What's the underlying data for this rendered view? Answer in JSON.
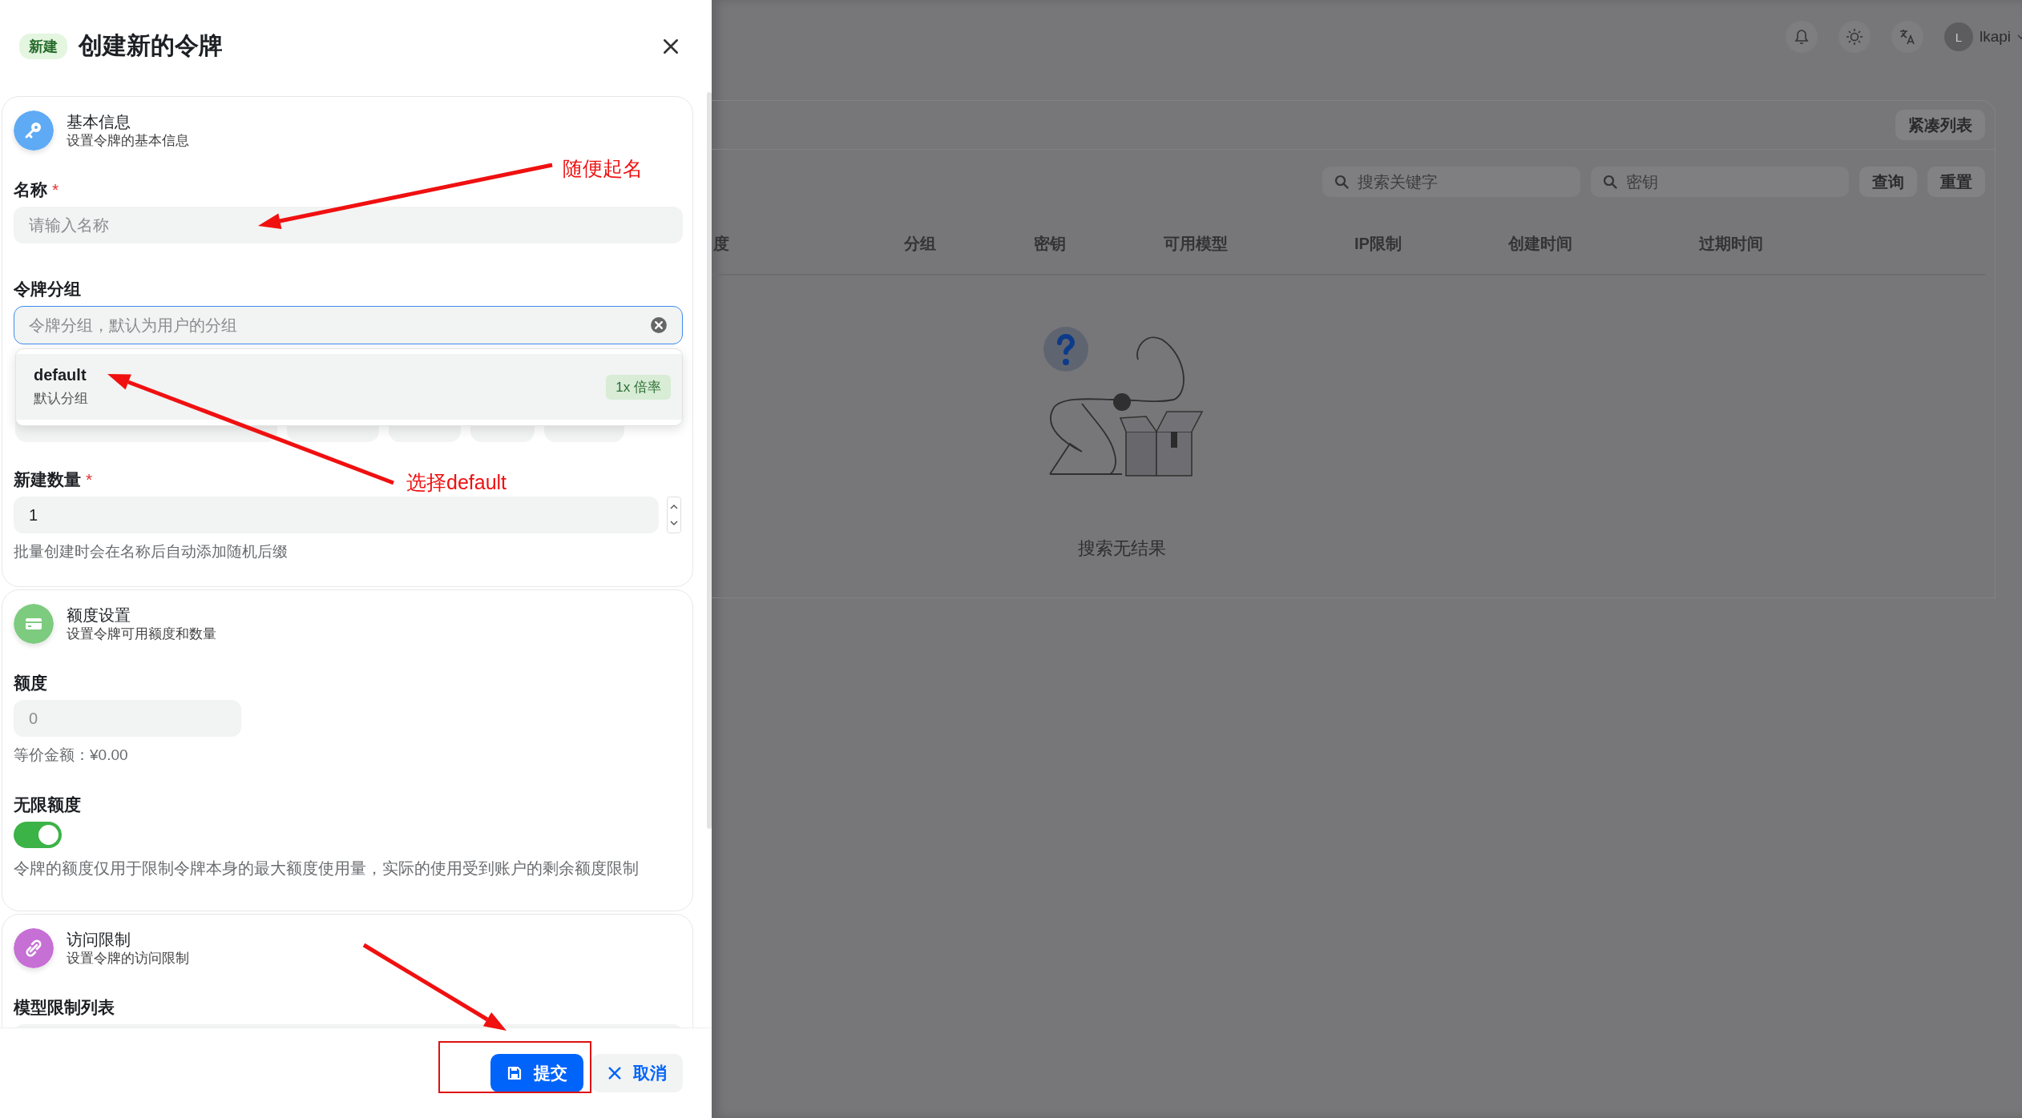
{
  "drawer": {
    "badge": "新建",
    "title": "创建新的令牌",
    "basic": {
      "title": "基本信息",
      "subtitle": "设置令牌的基本信息",
      "color": "#5eaaf5",
      "name_field": {
        "label": "名称",
        "required_mark": "*",
        "placeholder": "请输入名称"
      },
      "group_field": {
        "label": "令牌分组",
        "placeholder": "令牌分组，默认为用户的分组",
        "focused": true,
        "options": [
          {
            "name": "default",
            "description": "默认分组",
            "ratio": "1x 倍率",
            "selected": true
          }
        ]
      },
      "count_field": {
        "label": "新建数量",
        "required_mark": "*",
        "value": "1",
        "hint": "批量创建时会在名称后自动添加随机后缀"
      }
    },
    "quota": {
      "title": "额度设置",
      "subtitle": "设置令牌可用额度和数量",
      "color": "#7dcb7f",
      "amount_field": {
        "label": "额度",
        "placeholder": "0",
        "equivalent": "等价金额：¥0.00"
      },
      "unlimited": {
        "label": "无限额度",
        "on": true,
        "hint": "令牌的额度仅用于限制令牌本身的最大额度使用量，实际的使用受到账户的剩余额度限制"
      }
    },
    "access": {
      "title": "访问限制",
      "subtitle": "设置令牌的访问限制",
      "color": "#c66fd4",
      "model_limit_label": "模型限制列表"
    },
    "buttons": [
      {
        "kind": "primary",
        "label": "提交"
      },
      {
        "kind": "secondary",
        "label": "取消"
      }
    ]
  },
  "background_page": {
    "user": {
      "initial": "L",
      "name": "lkapi"
    },
    "compact_button": "紧凑列表",
    "search_fields": [
      {
        "placeholder": "搜索关键字"
      },
      {
        "placeholder": "密钥"
      }
    ],
    "actions": [
      "查询",
      "重置"
    ],
    "columns": [
      "度",
      "分组",
      "密钥",
      "可用模型",
      "IP限制",
      "创建时间",
      "过期时间"
    ],
    "empty_text": "搜索无结果"
  },
  "annotations": {
    "notes": [
      "随便起名",
      "选择default"
    ]
  }
}
